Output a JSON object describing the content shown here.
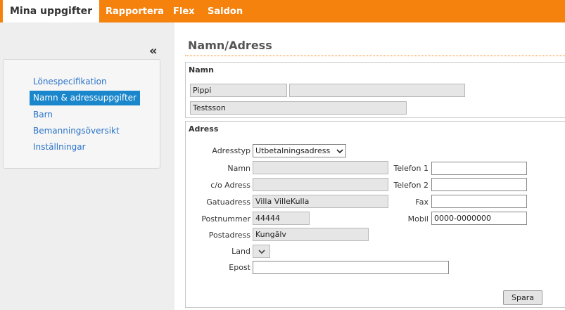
{
  "nav": {
    "tabs": [
      {
        "label": "Mina uppgifter",
        "active": true
      },
      {
        "label": "Rapportera"
      },
      {
        "label": "Flex"
      },
      {
        "label": "Saldon"
      }
    ],
    "accent": "#f5820d"
  },
  "sidebar": {
    "collapse_label": "«",
    "items": [
      {
        "label": "Lönespecifikation"
      },
      {
        "label": "Namn & adressuppgifter",
        "active": true
      },
      {
        "label": "Barn"
      },
      {
        "label": "Bemanningsöversikt"
      },
      {
        "label": "Inställningar"
      }
    ]
  },
  "page": {
    "title": "Namn/Adress"
  },
  "namn": {
    "title": "Namn",
    "first_name": "Pippi",
    "middle_name": "",
    "last_name": "Testsson"
  },
  "adress": {
    "title": "Adress",
    "adresstyp_label": "Adresstyp",
    "adresstyp_value": "Utbetalningsadress",
    "namn_label": "Namn",
    "namn_value": "",
    "co_label": "c/o Adress",
    "co_value": "",
    "gatu_label": "Gatuadress",
    "gatu_value": "Villa VilleKulla",
    "postnr_label": "Postnummer",
    "postnr_value": "44444",
    "postadress_label": "Postadress",
    "postadress_value": "Kungälv",
    "land_label": "Land",
    "land_value": "",
    "epost_label": "Epost",
    "epost_value": "",
    "tel1_label": "Telefon 1",
    "tel1_value": "",
    "tel2_label": "Telefon 2",
    "tel2_value": "",
    "fax_label": "Fax",
    "fax_value": "",
    "mobil_label": "Mobil",
    "mobil_value": "0000-0000000",
    "save_label": "Spara"
  }
}
